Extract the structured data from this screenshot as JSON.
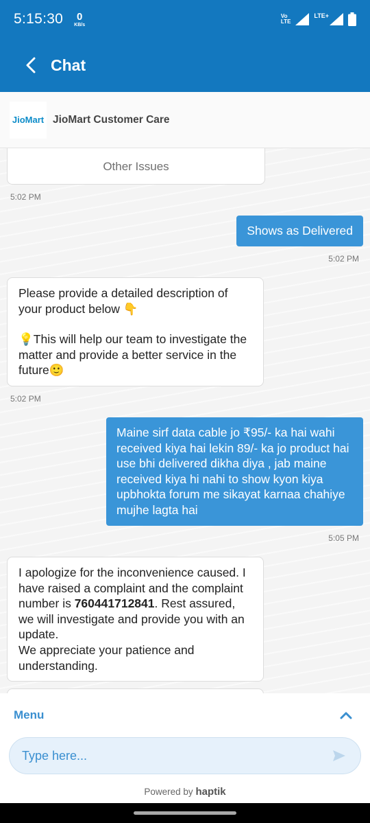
{
  "status_bar": {
    "time": "5:15:30",
    "net_speed_value": "0",
    "net_speed_unit": "KB/s",
    "volte_top": "Vo",
    "volte_bottom": "LTE",
    "lte_label": "LTE+",
    "icons": [
      "signal-icon",
      "wifi-call-icon",
      "battery-icon"
    ]
  },
  "header": {
    "title": "Chat"
  },
  "agent": {
    "logo_text": "JioMart",
    "name": "JioMart Customer Care"
  },
  "messages": [
    {
      "from": "bot",
      "type": "option",
      "text": "Other Issues",
      "time": "5:02 PM"
    },
    {
      "from": "user",
      "text": "Shows as Delivered",
      "time": "5:02 PM"
    },
    {
      "from": "bot",
      "line1": "Please provide a detailed description of your product below 👇",
      "line2": "💡This will help our team to investigate the matter and provide a better service in the future🙂",
      "time": "5:02 PM"
    },
    {
      "from": "user",
      "text": "Maine sirf data cable jo ₹95/- ka hai wahi received kiya hai lekin 89/- ka jo product hai use bhi delivered dikha diya , jab maine received kiya hi nahi to show kyon kiya upbhokta forum me sikayat karnaa chahiye mujhe lagta hai",
      "time": "5:05 PM"
    },
    {
      "from": "bot",
      "text_before": "I apologize for the inconvenience caused. I have raised a complaint and the complaint number is ",
      "complaint_number": "760441712841",
      "text_after": ". Rest assured, we will investigate and provide you with an update.",
      "line2": "We appreciate your patience and understanding."
    }
  ],
  "bottom": {
    "menu_label": "Menu",
    "input_placeholder": "Type here...",
    "powered_by": "Powered by",
    "brand": "haptik"
  },
  "colors": {
    "primary": "#1378bf",
    "user_bubble": "#3a95d8",
    "accent": "#3a8fd0"
  }
}
